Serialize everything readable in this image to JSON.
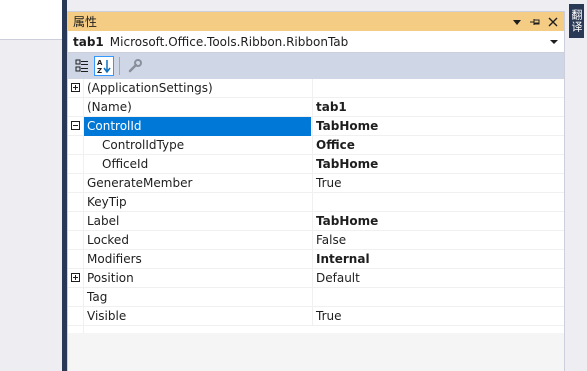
{
  "side_tab": {
    "label": "翻译"
  },
  "window": {
    "title": "属性",
    "buttons": [
      "window-position-menu",
      "auto-hide",
      "close"
    ]
  },
  "object_selector": {
    "name": "tab1",
    "type": "Microsoft.Office.Tools.Ribbon.RibbonTab"
  },
  "toolbar": {
    "categorized_label": "Categorized",
    "alphabetical_label": "Alphabetical",
    "property_pages_label": "Property Pages",
    "active": "alphabetical"
  },
  "properties": [
    {
      "name": "(ApplicationSettings)",
      "value": "",
      "bold": false,
      "expander": "plus",
      "indent": 0
    },
    {
      "name": "(Name)",
      "value": "tab1",
      "bold": true,
      "expander": "",
      "indent": 0
    },
    {
      "name": "ControlId",
      "value": "TabHome",
      "bold": true,
      "expander": "minus",
      "indent": 0,
      "selected": true
    },
    {
      "name": "ControlIdType",
      "value": "Office",
      "bold": true,
      "expander": "",
      "indent": 1
    },
    {
      "name": "OfficeId",
      "value": "TabHome",
      "bold": true,
      "expander": "",
      "indent": 1
    },
    {
      "name": "GenerateMember",
      "value": "True",
      "bold": false,
      "expander": "",
      "indent": 0
    },
    {
      "name": "KeyTip",
      "value": "",
      "bold": false,
      "expander": "",
      "indent": 0
    },
    {
      "name": "Label",
      "value": "TabHome",
      "bold": true,
      "expander": "",
      "indent": 0
    },
    {
      "name": "Locked",
      "value": "False",
      "bold": false,
      "expander": "",
      "indent": 0
    },
    {
      "name": "Modifiers",
      "value": "Internal",
      "bold": true,
      "expander": "",
      "indent": 0
    },
    {
      "name": "Position",
      "value": "Default",
      "bold": false,
      "expander": "plus",
      "indent": 0
    },
    {
      "name": "Tag",
      "value": "",
      "bold": false,
      "expander": "",
      "indent": 0
    },
    {
      "name": "Visible",
      "value": "True",
      "bold": false,
      "expander": "",
      "indent": 0
    }
  ],
  "colors": {
    "title_active": "#F5CC84",
    "selection": "#0078D7",
    "toolbar": "#CFD6E5",
    "dark_frame": "#293955"
  }
}
